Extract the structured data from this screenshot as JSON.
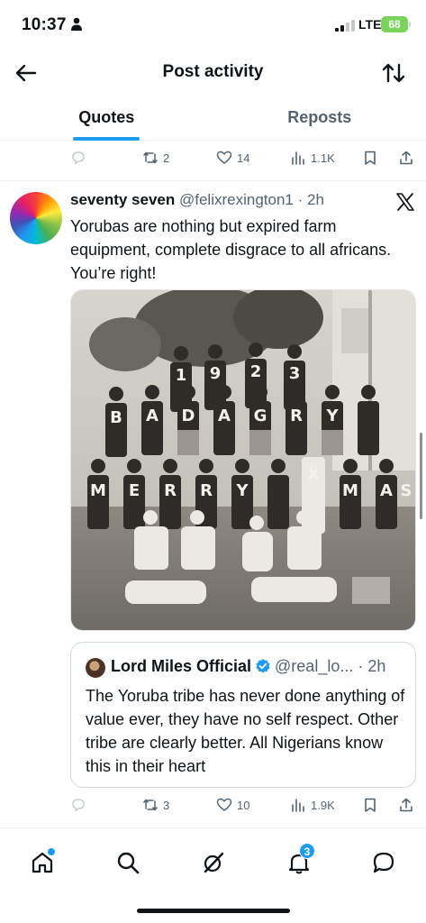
{
  "status_bar": {
    "time": "10:37",
    "network": "LTE",
    "battery": "68"
  },
  "header": {
    "title": "Post activity",
    "back_icon": "arrow-left-icon",
    "sort_icon": "sort-arrows-icon"
  },
  "tabs": [
    {
      "label": "Quotes",
      "active": true
    },
    {
      "label": "Reposts",
      "active": false
    }
  ],
  "prev_post_actions": {
    "replies": "",
    "reposts": "2",
    "likes": "14",
    "views": "1.1K"
  },
  "post": {
    "author_name": "seventy seven",
    "author_handle": "@felixrexington1",
    "time": "· 2h",
    "text": "Yorubas are nothing but expired farm equipment, complete disgrace to all africans. You’re right!",
    "photo_letters": [
      "1",
      "9",
      "2",
      "3",
      "B",
      "A",
      "D",
      "A",
      "G",
      "R",
      "Y",
      "M",
      "E",
      "R",
      "R",
      "Y",
      "X",
      "M",
      "A",
      "S"
    ],
    "quote": {
      "author_name": "Lord Miles Official",
      "author_handle": "@real_lo...",
      "time": "· 2h",
      "text": "The Yoruba tribe has never done anything of value ever, they have no self respect. Other tribe are clearly better. All Nigerians know this in their heart"
    },
    "actions": {
      "replies": "",
      "reposts": "3",
      "likes": "10",
      "views": "1.9K"
    }
  },
  "bottom_nav": {
    "items": [
      "home-icon",
      "search-icon",
      "grok-icon",
      "notifications-icon",
      "messages-icon"
    ],
    "notification_count": "3"
  },
  "colors": {
    "accent": "#1d9bf0",
    "text_primary": "#0f1419",
    "text_secondary": "#536471",
    "battery": "#7ad35a"
  }
}
